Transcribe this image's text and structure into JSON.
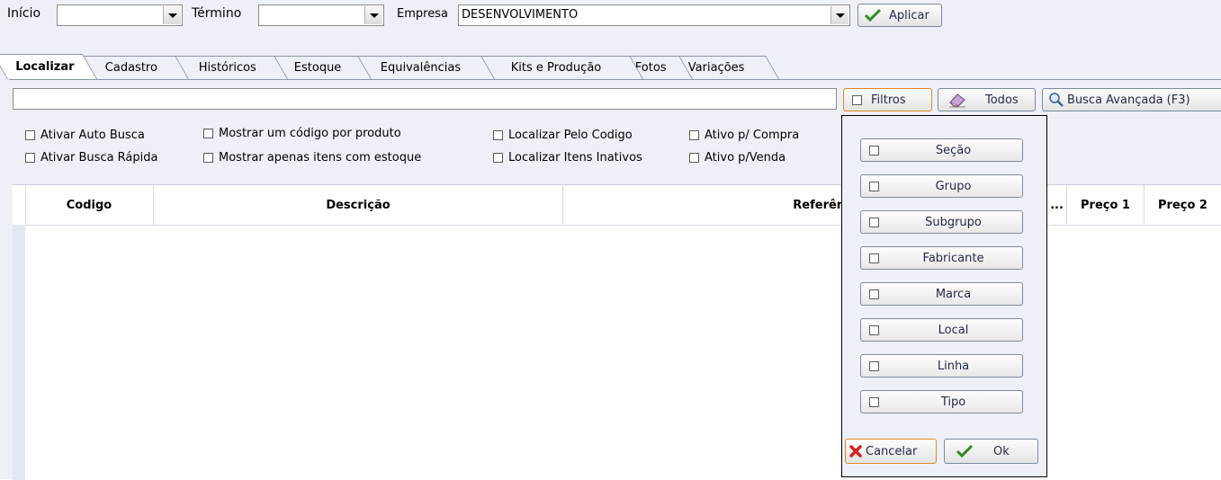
{
  "header": {
    "inicio_label": "Início",
    "inicio_value": "",
    "termino_label": "Término",
    "termino_value": "",
    "empresa_label": "Empresa",
    "empresa_value": "DESENVOLVIMENTO",
    "aplicar_label": "Aplicar"
  },
  "tabs": [
    {
      "label": "Localizar"
    },
    {
      "label": "Cadastro"
    },
    {
      "label": "Históricos"
    },
    {
      "label": "Estoque"
    },
    {
      "label": "Equivalências"
    },
    {
      "label": "Kits e Produção"
    },
    {
      "label": "Fotos"
    },
    {
      "label": "Variações"
    }
  ],
  "search": {
    "value": "",
    "filtros_label": "Filtros",
    "todos_label": "Todos",
    "busca_avancada_label": "Busca Avançada (F3)"
  },
  "options": {
    "ativar_auto_busca": "Ativar Auto Busca",
    "ativar_busca_rapida": "Ativar Busca Rápida",
    "mostrar_um_codigo": "Mostrar um código por produto",
    "mostrar_apenas_estoque": "Mostrar apenas itens com estoque",
    "localizar_pelo_codigo": "Localizar Pelo Codigo",
    "localizar_inativos": "Localizar Itens Inativos",
    "ativo_compra": "Ativo p/ Compra",
    "ativo_venda": "Ativo p/Venda"
  },
  "grid": {
    "columns": [
      "Codigo",
      "Descrição",
      "Referência",
      "...",
      "Preço 1",
      "Preço 2"
    ]
  },
  "filter_popup": {
    "items": [
      "Seção",
      "Grupo",
      "Subgrupo",
      "Fabricante",
      "Marca",
      "Local",
      "Linha",
      "Tipo"
    ],
    "cancel_label": "Cancelar",
    "ok_label": "Ok"
  },
  "colors": {
    "panel": "#eef0f7",
    "check_green": "#2e8b1e",
    "cancel_red": "#d42020",
    "highlight_orange": "#e08a1e"
  }
}
